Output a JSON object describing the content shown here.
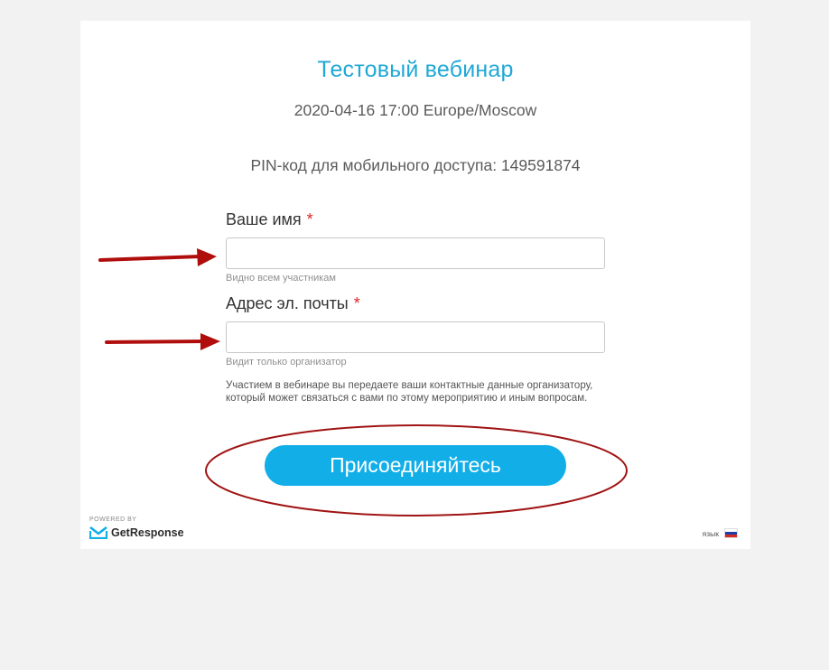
{
  "webinar": {
    "title": "Тестовый вебинар",
    "datetime": "2020-04-16 17:00 Europe/Moscow",
    "pin": "PIN-код для мобильного доступа: 149591874"
  },
  "form": {
    "name_label": "Ваше имя",
    "name_required": "*",
    "name_value": "",
    "name_hint": "Видно всем участникам",
    "email_label": "Адрес эл. почты",
    "email_required": "*",
    "email_value": "",
    "email_hint": "Видит только организатор",
    "notice": "Участием в вебинаре вы передаете ваши контактные данные организатору, который может связаться с вами по этому мероприятию и иным вопросам.",
    "join_label": "Присоединяйтесь"
  },
  "footer": {
    "powered_by": "POWERED BY",
    "brand": "GetResponse",
    "language_label": "язык",
    "flag_colors": [
      "#ffffff",
      "#1c3fa8",
      "#d52b1e"
    ]
  },
  "annotations": {
    "color": "#b00d0d",
    "arrows": [
      "name-input",
      "email-input"
    ],
    "circled": "join-button"
  }
}
